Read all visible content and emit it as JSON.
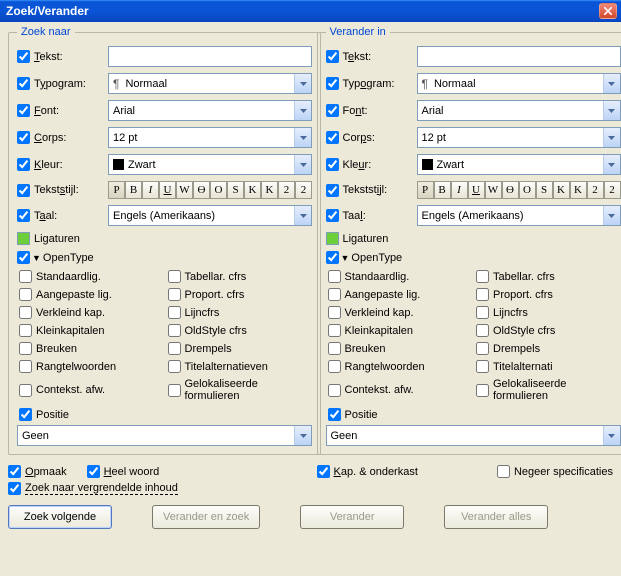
{
  "window": {
    "title": "Zoek/Verander"
  },
  "search": {
    "legend": "Zoek naar",
    "tekst_label": "Tekst:",
    "tekst_u": "T",
    "tekst_value": "",
    "typogram_label_pre": "T",
    "typogram_u": "y",
    "typogram_label_post": "pogram:",
    "typogram_value": "Normaal",
    "font_label": "Font:",
    "font_u": "F",
    "font_value": "Arial",
    "corps_label": "Corps:",
    "corps_u": "C",
    "corps_value": "12 pt",
    "kleur_label": "Kleur:",
    "kleur_u": "K",
    "kleur_value": "Zwart",
    "tekststijl_label": "Tekststijl:",
    "tekststijl_u": "s",
    "taal_label": "Taal:",
    "taal_u": "a",
    "taal_value": "Engels (Amerikaans)",
    "ligaturen": "Ligaturen",
    "opentype": "OpenType",
    "ot": {
      "standaardlig": "Standaardlig.",
      "tabellar": "Tabellar. cfrs",
      "aangepaste": "Aangepaste lig.",
      "proport": "Proport. cfrs",
      "verkleind": "Verkleind kap.",
      "lijncfrs": "Lijncfrs",
      "kleinkap": "Kleinkapitalen",
      "oldstyle": "OldStyle cfrs",
      "breuken": "Breuken",
      "drempels": "Drempels",
      "rangtel": "Rangtelwoorden",
      "titelalt": "Titelalternatieven",
      "contekst": "Contekst. afw.",
      "gelok": "Gelokaliseerde formulieren"
    },
    "positie": "Positie",
    "positie_value": "Geen"
  },
  "replace": {
    "legend": "Verander in",
    "tekst_label": "Tekst:",
    "tekst_u": "e",
    "tekst_value": "",
    "typogram_label": "Typogram:",
    "typogram_u": "o",
    "typogram_value": "Normaal",
    "font_label": "Font:",
    "font_u": "n",
    "font_value": "Arial",
    "corps_label": "Corps:",
    "corps_u": "p",
    "corps_value": "12 pt",
    "kleur_label": "Kleur:",
    "kleur_u": "u",
    "kleur_value": "Zwart",
    "tekststijl_label": "Tekststijl:",
    "tekststijl_u": "i",
    "taal_label": "Taal:",
    "taal_u": "l",
    "taal_value": "Engels (Amerikaans)",
    "ligaturen": "Ligaturen",
    "opentype": "OpenType",
    "ot": {
      "standaardlig": "Standaardlig.",
      "tabellar": "Tabellar. cfrs",
      "aangepaste": "Aangepaste lig.",
      "proport": "Proport. cfrs",
      "verkleind": "Verkleind kap.",
      "lijncfrs": "Lijncfrs",
      "kleinkap": "Kleinkapitalen",
      "oldstyle": "OldStyle cfrs",
      "breuken": "Breuken",
      "drempels": "Drempels",
      "rangtel": "Rangtelwoorden",
      "titelalt": "Titelalternati",
      "contekst": "Contekst. afw.",
      "gelok": "Gelokaliseerde formulieren"
    },
    "positie": "Positie",
    "positie_value": "Geen"
  },
  "footer": {
    "opmaak": "Opmaak",
    "opmaak_u": "O",
    "heelwoord": "Heel woord",
    "heelwoord_u": "H",
    "kap": "Kap. & onderkast",
    "kap_u": "K",
    "negeer": "Negeer specificaties",
    "locked": "Zoek naar vergrendelde inhoud",
    "locked_u": "Z"
  },
  "buttons": {
    "find_next": "Zoek volgende",
    "change_find": "Verander en zoek",
    "change": "Verander",
    "change_all": "Verander alles"
  },
  "stylebtns": [
    "P",
    "B",
    "I",
    "U",
    "W",
    "Ө",
    "O",
    "S",
    "K",
    "K",
    "2",
    "2"
  ]
}
